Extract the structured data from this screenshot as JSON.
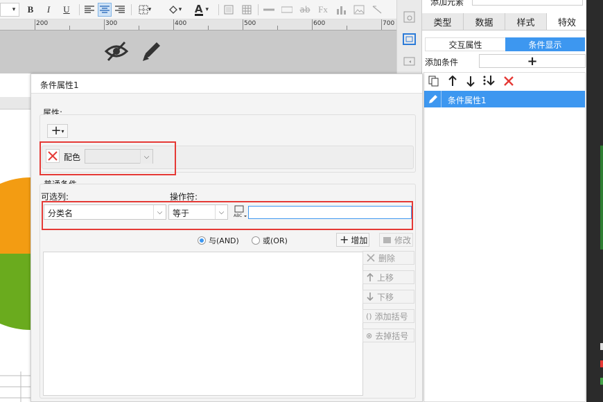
{
  "ruler": {
    "ticks": [
      "200",
      "300",
      "400",
      "500",
      "600",
      "700"
    ]
  },
  "right_panel": {
    "top_label": "添加元素",
    "tabs": [
      "类型",
      "数据",
      "样式",
      "特效"
    ],
    "subtabs": [
      "交互属性",
      "条件显示"
    ],
    "add_condition_label": "添加条件",
    "add_glyph": "+",
    "list_items": [
      "条件属性1"
    ]
  },
  "dialog": {
    "title": "条件属性1",
    "attr_label": "属性:",
    "attr_item_label": "配色",
    "normal_cond_label": "普通条件",
    "optional_col_label": "可选列:",
    "operator_label": "操作符:",
    "column_value": "分类名",
    "operator_value": "等于",
    "value_input": "",
    "and_label": "与(AND)",
    "or_label": "或(OR)",
    "add_button": "增加",
    "modify_button": "修改",
    "delete_button": "删除",
    "up_button": "上移",
    "down_button": "下移",
    "add_bracket_button": "添加括号",
    "remove_bracket_button": "去掉括号"
  },
  "colors": {
    "accent": "#3d97f0",
    "red": "#e53935",
    "pie_orange": "#f39c12",
    "pie_green": "#6aab1e"
  }
}
